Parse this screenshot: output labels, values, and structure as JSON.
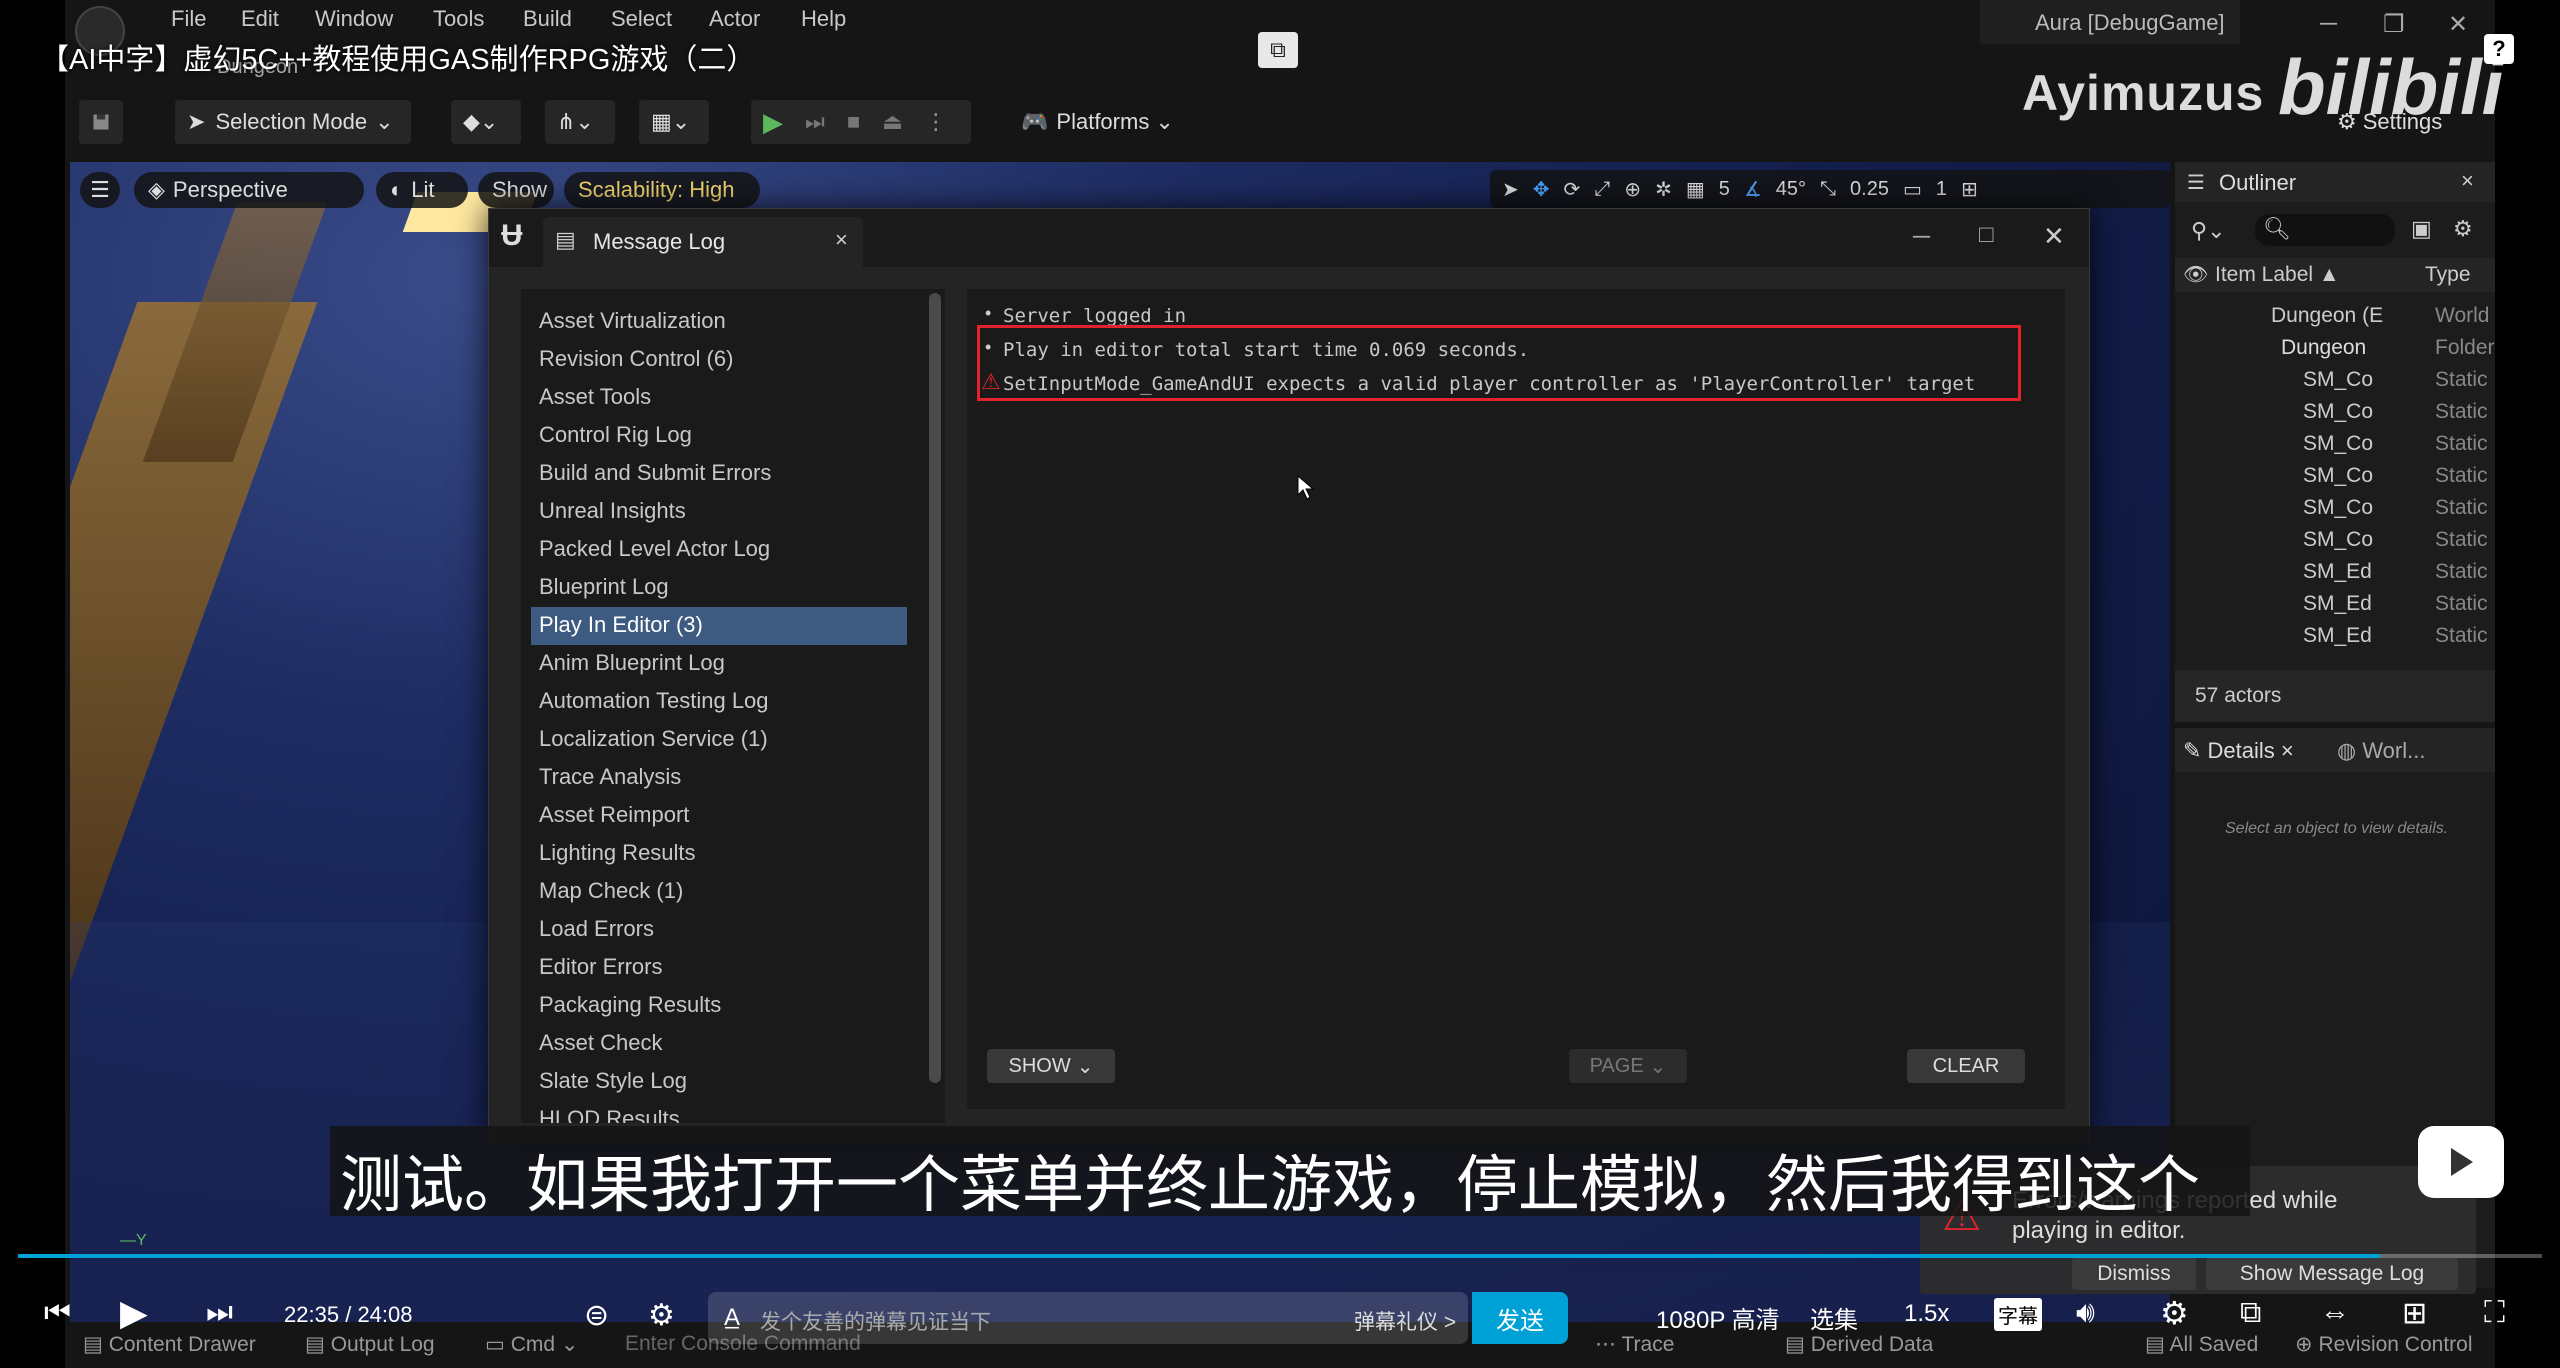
{
  "video": {
    "title": "【AI中字】虚幻5C++教程使用GAS制作RPG游戏（二）",
    "uploader_watermark": "Ayimuzus",
    "platform_logo": "bilibili",
    "subtitle": "测试。如果我打开一个菜单并终止游戏，停止模拟，然后我得到这个",
    "current_time": "22:35",
    "time_separator": "/",
    "duration": "24:08",
    "progress_fraction": 0.936,
    "danmaku_placeholder": "发个友善的弹幕见证当下",
    "danmaku_etiquette": "弹幕礼仪 >",
    "send_label": "发送",
    "quality_label": "1080P 高清",
    "episodes_label": "选集",
    "speed_label": "1.5x",
    "subtitle_toggle_label": "字幕"
  },
  "editor": {
    "menu": [
      "File",
      "Edit",
      "Window",
      "Tools",
      "Build",
      "Select",
      "Actor",
      "Help"
    ],
    "level_tab": "Dungeon",
    "window_title": "Aura [DebugGame]",
    "settings_label": "Settings",
    "toolbar": {
      "selection_mode": "Selection Mode",
      "platforms": "Platforms"
    },
    "viewport": {
      "perspective": "Perspective",
      "lit": "Lit",
      "show": "Show",
      "scalability": "Scalability: High",
      "grid_value": "5",
      "angle_value": "45°",
      "scale_value": "0.25",
      "camera_speed": "1"
    },
    "outliner": {
      "title": "Outliner",
      "col_label": "Item Label ▲",
      "col_type": "Type",
      "rows": [
        {
          "name": "Dungeon (E",
          "type": "World"
        },
        {
          "name": "Dungeon",
          "type": "Folder"
        },
        {
          "name": "SM_Co",
          "type": "Static"
        },
        {
          "name": "SM_Co",
          "type": "Static"
        },
        {
          "name": "SM_Co",
          "type": "Static"
        },
        {
          "name": "SM_Co",
          "type": "Static"
        },
        {
          "name": "SM_Co",
          "type": "Static"
        },
        {
          "name": "SM_Co",
          "type": "Static"
        },
        {
          "name": "SM_Ed",
          "type": "Static"
        },
        {
          "name": "SM_Ed",
          "type": "Static"
        },
        {
          "name": "SM_Ed",
          "type": "Static"
        }
      ],
      "actor_count": "57 actors"
    },
    "details": {
      "tab_details": "Details",
      "tab_world": "Worl...",
      "empty_text": "Select an object to view details."
    },
    "statusbar": {
      "content_drawer": "Content Drawer",
      "output_log": "Output Log",
      "cmd": "Cmd",
      "console_placeholder": "Enter Console Command",
      "trace": "Trace",
      "derived_data": "Derived Data",
      "all_saved": "All Saved",
      "revision_control": "Revision Control"
    },
    "error_toast": {
      "message": "Errors/warnings reported while playing in editor.",
      "dismiss": "Dismiss",
      "show_log": "Show Message Log"
    }
  },
  "message_log": {
    "title": "Message Log",
    "categories": [
      "Asset Virtualization",
      "Revision Control (6)",
      "Asset Tools",
      "Control Rig Log",
      "Build and Submit Errors",
      "Unreal Insights",
      "Packed Level Actor Log",
      "Blueprint Log",
      "Play In Editor (3)",
      "Anim Blueprint Log",
      "Automation Testing Log",
      "Localization Service (1)",
      "Trace Analysis",
      "Asset Reimport",
      "Lighting Results",
      "Map Check (1)",
      "Load Errors",
      "Editor Errors",
      "Packaging Results",
      "Asset Check",
      "Slate Style Log",
      "HLOD Results"
    ],
    "selected_category": "Play In Editor (3)",
    "entries": [
      {
        "kind": "info",
        "text": "Server logged in"
      },
      {
        "kind": "info",
        "text": "Play in editor total start time 0.069 seconds."
      },
      {
        "kind": "warning",
        "text": "SetInputMode_GameAndUI expects a valid player controller as 'PlayerController' target"
      }
    ],
    "show_button": "SHOW",
    "page_button": "PAGE",
    "clear_button": "CLEAR"
  },
  "colors": {
    "accent_blue": "#00a1d6",
    "selection_blue": "#3d5a80",
    "highlight_red": "#e0232c",
    "play_green": "#5cb85c"
  }
}
